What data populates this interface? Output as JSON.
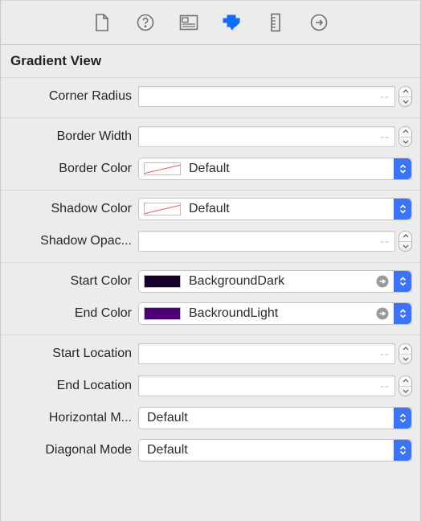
{
  "section": {
    "title": "Gradient View"
  },
  "fields": {
    "cornerRadius": {
      "label": "Corner Radius",
      "placeholder": "--"
    },
    "borderWidth": {
      "label": "Border Width",
      "placeholder": "--"
    },
    "borderColor": {
      "label": "Border Color",
      "value": "Default"
    },
    "shadowColor": {
      "label": "Shadow Color",
      "value": "Default"
    },
    "shadowOpacity": {
      "label": "Shadow Opac...",
      "placeholder": "--"
    },
    "startColor": {
      "label": "Start Color",
      "value": "BackgroundDark",
      "swatch": "#16002a",
      "swatchStyle": "background:#16002a"
    },
    "endColor": {
      "label": "End Color",
      "value": "BackroundLight",
      "swatch": "#4c0073",
      "swatchStyle": "background:#4c0073"
    },
    "startLocation": {
      "label": "Start Location",
      "placeholder": "--"
    },
    "endLocation": {
      "label": "End Location",
      "placeholder": "--"
    },
    "horizontalMode": {
      "label": "Horizontal M...",
      "value": "Default"
    },
    "diagonalMode": {
      "label": "Diagonal Mode",
      "value": "Default"
    }
  },
  "colors": {
    "accent": "#3b74f7"
  }
}
